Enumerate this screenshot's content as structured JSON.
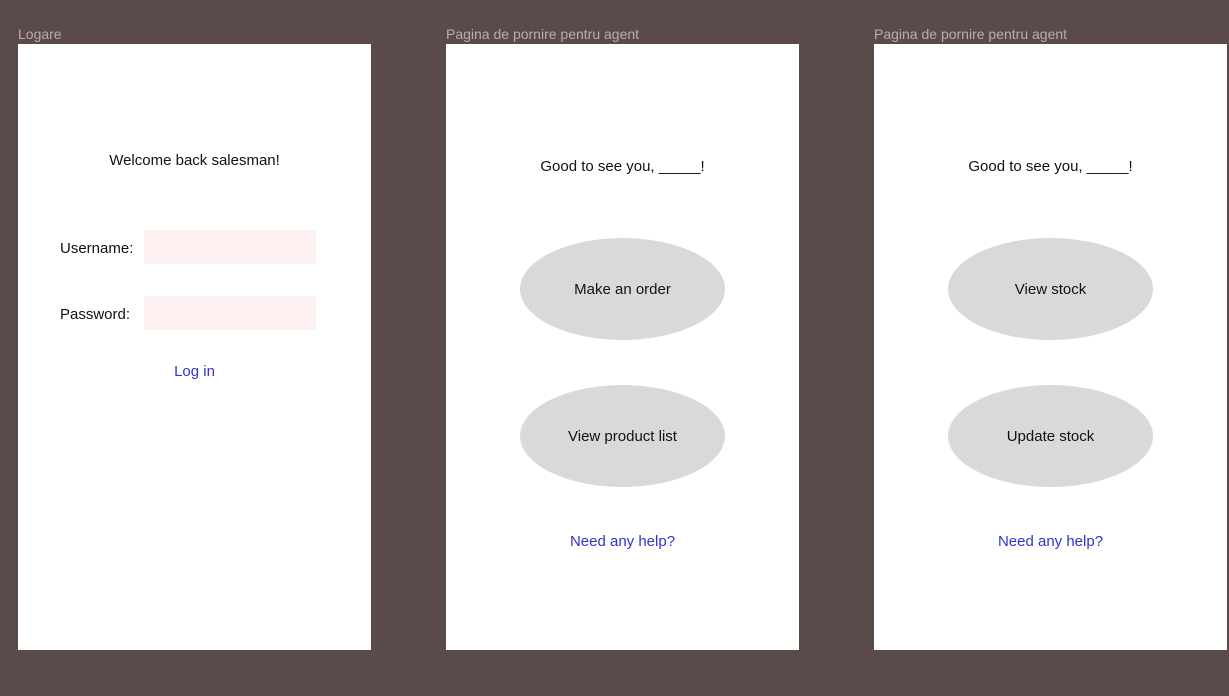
{
  "frames": {
    "login": {
      "frame_label": "Logare",
      "greeting": "Welcome back salesman!",
      "username_label": "Username:",
      "username_value": "",
      "password_label": "Password:",
      "password_value": "",
      "login_link": "Log in"
    },
    "agent_home_1": {
      "frame_label": "Pagina de pornire pentru agent",
      "greeting": "Good to see you, _____!",
      "button_1": "Make an order",
      "button_2": "View product list",
      "help_link": "Need any help?"
    },
    "agent_home_2": {
      "frame_label": "Pagina de pornire pentru agent",
      "greeting": "Good to see you, _____!",
      "button_1": "View stock",
      "button_2": "Update stock",
      "help_link": "Need any help?"
    }
  },
  "colors": {
    "canvas": "#5a4a49",
    "frame": "#ffffff",
    "input_bg": "#fff1f1",
    "link": "#3232c8",
    "oval": "#d9d9d9"
  }
}
